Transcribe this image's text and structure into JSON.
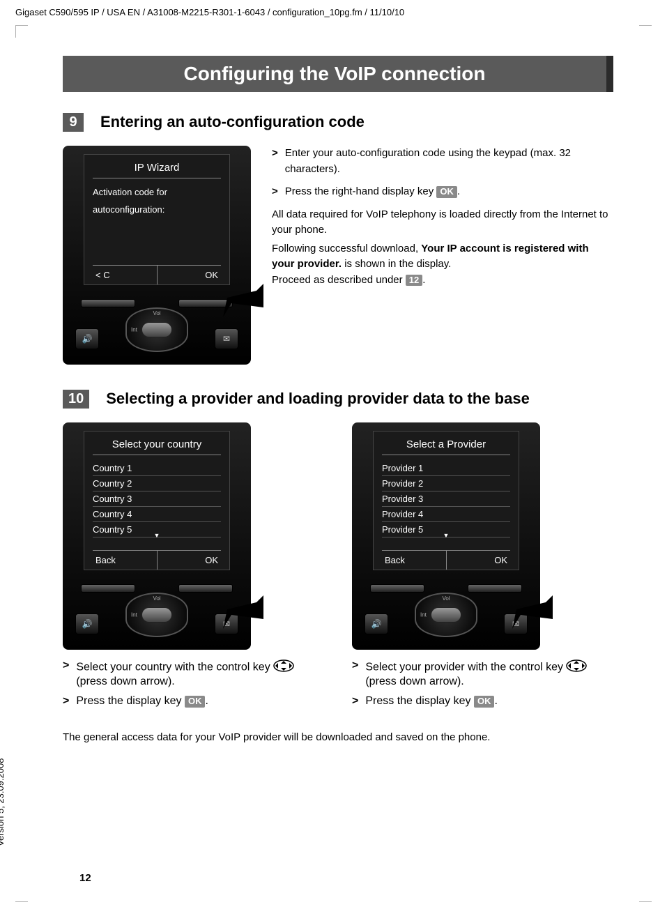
{
  "header": "Gigaset C590/595 IP / USA EN / A31008-M2215-R301-1-6043 / configuration_10pg.fm / 11/10/10",
  "version": "Version 5, 23.09.2008",
  "page_number": "12",
  "title": "Configuring the VoIP connection",
  "step9": {
    "num": "9",
    "title": "Entering an auto-configuration code",
    "screen_title": "IP Wizard",
    "screen_line1": "Activation code for",
    "screen_line2": "autoconfiguration:",
    "soft_left": "< C",
    "soft_right": "OK",
    "bullet1": "Enter your auto-configuration code using the keypad (max. 32 characters).",
    "bullet2_pre": "Press the right-hand display key ",
    "bullet2_key": "OK",
    "bullet2_post": ".",
    "para1": "All data required for VoIP telephony is loaded directly from the Internet to your phone.",
    "para2_pre": "Following successful download, ",
    "para2_bold": "Your IP account is registered with your provider.",
    "para2_post": " is shown in the display.",
    "para3_pre": "Proceed as described under ",
    "para3_key": "12",
    "para3_post": "."
  },
  "step10": {
    "num": "10",
    "title": "Selecting a provider and loading provider data to the base",
    "country_screen": {
      "title": "Select your country",
      "items": [
        "Country 1",
        "Country 2",
        "Country 3",
        "Country 4",
        "Country 5"
      ],
      "soft_left": "Back",
      "soft_right": "OK"
    },
    "provider_screen": {
      "title": "Select a Provider",
      "items": [
        "Provider 1",
        "Provider 2",
        "Provider 3",
        "Provider 4",
        "Provider 5"
      ],
      "soft_left": "Back",
      "soft_right": "OK"
    },
    "country_bullet1_pre": "Select your country with the control key ",
    "country_bullet1_post": " (press down arrow).",
    "country_bullet2_pre": "Press the display key ",
    "country_bullet2_key": "OK",
    "country_bullet2_post": ".",
    "provider_bullet1_pre": "Select your provider with the control key ",
    "provider_bullet1_post": " (press down arrow).",
    "provider_bullet2_pre": "Press the display key ",
    "provider_bullet2_key": "OK",
    "provider_bullet2_post": ".",
    "final": "The general access data for your VoIP provider will be downloaded and saved on the phone."
  },
  "dpad": {
    "vol": "Vol",
    "int": "Int"
  },
  "icons": {
    "speaker": "🔊",
    "mail": "✉"
  }
}
